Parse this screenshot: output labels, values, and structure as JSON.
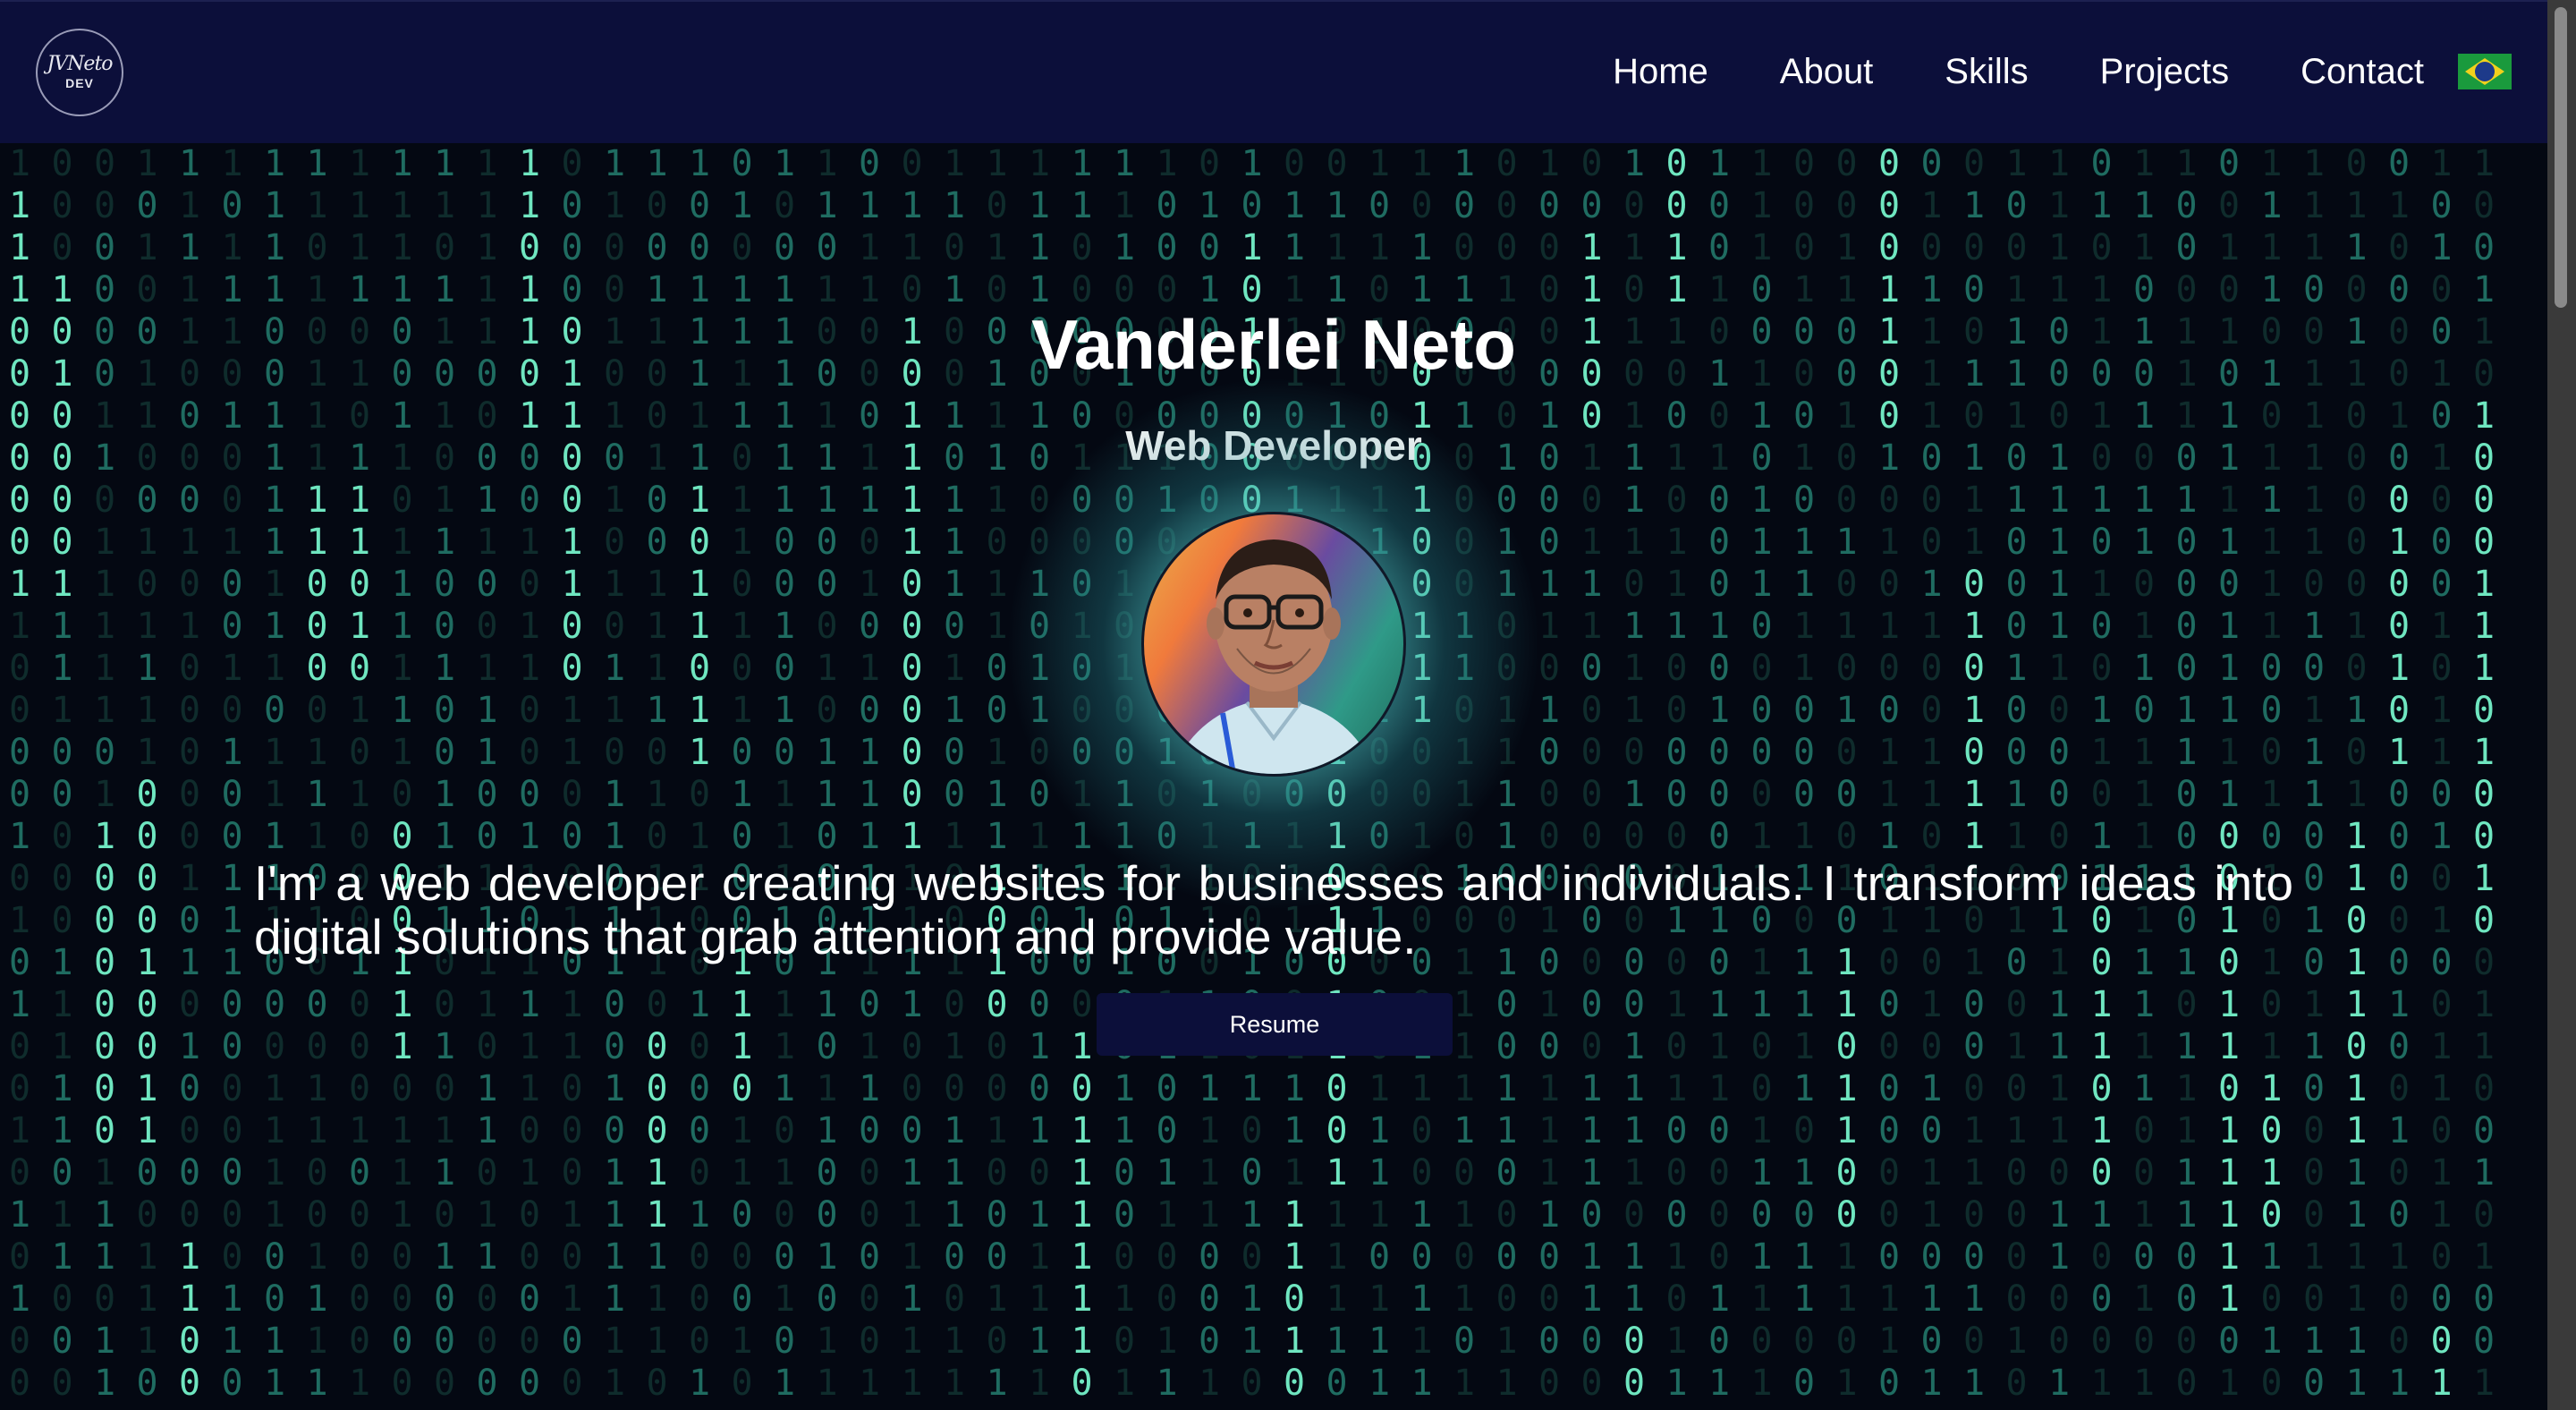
{
  "nav": {
    "logo_script": "JVNeto",
    "logo_sub": "DEV",
    "links": [
      "Home",
      "About",
      "Skills",
      "Projects",
      "Contact"
    ],
    "language_flag": "brazil-flag-icon"
  },
  "hero": {
    "name": "Vanderlei Neto",
    "role": "Web Developer",
    "bio": "I'm a web developer creating websites for businesses and individuals. I transform ideas into digital solutions that grab attention and provide value.",
    "resume_label": "Resume"
  },
  "colors": {
    "nav_background": "#0c0f3a",
    "page_background": "#040812",
    "matrix_bright": "#6fe6c0",
    "matrix_mid": "#1f6c61",
    "matrix_dim": "#0f2c2c",
    "button_background": "#0c0f3a",
    "text": "#ffffff"
  },
  "background": {
    "style": "matrix-rain",
    "digits": "01"
  }
}
